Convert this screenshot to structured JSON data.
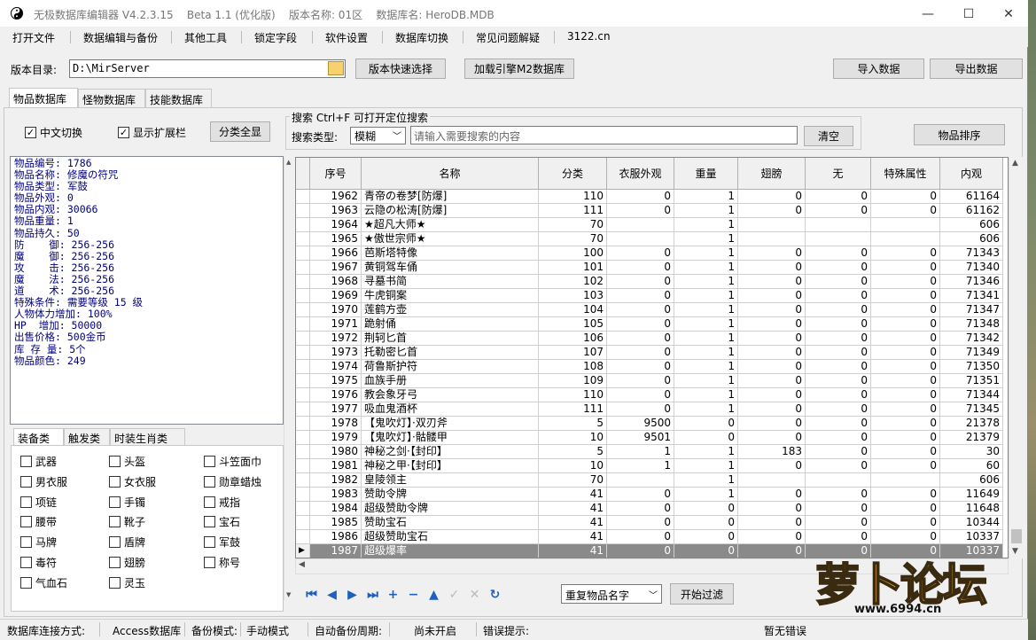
{
  "window": {
    "title_parts": [
      "无极数据库编辑器 V4.2.3.15",
      "Beta 1.1 (优化版)",
      "版本名称: 01区",
      "数据库名: HeroDB.MDB"
    ],
    "controls": [
      "—",
      "☐",
      "✕"
    ]
  },
  "menu": [
    "打开文件",
    "数据编辑与备份",
    "其他工具",
    "锁定字段",
    "软件设置",
    "数据库切换",
    "常见问题解疑",
    "3122.cn"
  ],
  "toolbar": {
    "dir_label": "版本目录:",
    "dir_value": "D:\\MirServer",
    "quick_select": "版本快速选择",
    "load_m2": "加载引擎M2数据库",
    "import": "导入数据",
    "export": "导出数据"
  },
  "tabs": [
    "物品数据库",
    "怪物数据库",
    "技能数据库"
  ],
  "options": {
    "chinese_switch": "中文切换",
    "show_ext": "显示扩展栏",
    "show_all": "分类全显",
    "sort": "物品排序"
  },
  "search": {
    "legend": "搜索  Ctrl+F 可打开定位搜索",
    "type_label": "搜索类型:",
    "type_value": "模糊",
    "placeholder": "请输入需要搜索的内容",
    "clear": "清空"
  },
  "item_info": [
    "物品编号: 1786",
    "物品名称: 修魔の符咒",
    "物品类型: 军鼓",
    "物品外观: 0",
    "物品内观: 30066",
    "物品重量: 1",
    "物品持久: 50",
    "防    御: 256-256",
    "魔    御: 256-256",
    "攻    击: 256-256",
    "魔    法: 256-256",
    "道    术: 256-256",
    "特殊条件: 需要等级 15 级",
    "人物体力增加: 100%",
    "HP  增加: 50000",
    "出售价格: 500金币",
    "库 存 量: 5个",
    "物品颜色: 249"
  ],
  "category_tabs": [
    "装备类",
    "触发类",
    "时装生肖类"
  ],
  "categories": [
    [
      "武器",
      "头盔",
      "斗笠面巾"
    ],
    [
      "男衣服",
      "女衣服",
      "勋章蜡烛"
    ],
    [
      "项链",
      "手镯",
      "戒指"
    ],
    [
      "腰带",
      "靴子",
      "宝石"
    ],
    [
      "马牌",
      "盾牌",
      "军鼓"
    ],
    [
      "毒符",
      "翅膀",
      "称号"
    ],
    [
      "气血石",
      "灵玉",
      ""
    ]
  ],
  "table": {
    "headers": [
      "序号",
      "名称",
      "分类",
      "衣服外观",
      "重量",
      "翅膀",
      "无",
      "特殊属性",
      "内观"
    ],
    "rows": [
      [
        "1962",
        "青帝の卷梦[防爆]",
        "110",
        "0",
        "1",
        "0",
        "0",
        "0",
        "61164"
      ],
      [
        "1963",
        "云隐の松涛[防爆]",
        "111",
        "0",
        "1",
        "0",
        "0",
        "0",
        "61162"
      ],
      [
        "1964",
        "★超凡大师★",
        "70",
        "",
        "1",
        "",
        "",
        "",
        "606"
      ],
      [
        "1965",
        "★傲世宗师★",
        "70",
        "",
        "1",
        "",
        "",
        "",
        "606"
      ],
      [
        "1966",
        "芭斯塔特像",
        "100",
        "0",
        "1",
        "0",
        "0",
        "0",
        "71343"
      ],
      [
        "1967",
        "黄铜驾车俑",
        "101",
        "0",
        "1",
        "0",
        "0",
        "0",
        "71340"
      ],
      [
        "1968",
        "寻墓书简",
        "102",
        "0",
        "1",
        "0",
        "0",
        "0",
        "71346"
      ],
      [
        "1969",
        "牛虎铜案",
        "103",
        "0",
        "1",
        "0",
        "0",
        "0",
        "71341"
      ],
      [
        "1970",
        "莲鹤方壶",
        "104",
        "0",
        "1",
        "0",
        "0",
        "0",
        "71347"
      ],
      [
        "1971",
        "跪射俑",
        "105",
        "0",
        "1",
        "0",
        "0",
        "0",
        "71348"
      ],
      [
        "1972",
        "荆轲匕首",
        "106",
        "0",
        "1",
        "0",
        "0",
        "0",
        "71342"
      ],
      [
        "1973",
        "托勒密匕首",
        "107",
        "0",
        "1",
        "0",
        "0",
        "0",
        "71349"
      ],
      [
        "1974",
        "荷鲁斯护符",
        "108",
        "0",
        "1",
        "0",
        "0",
        "0",
        "71350"
      ],
      [
        "1975",
        "血族手册",
        "109",
        "0",
        "1",
        "0",
        "0",
        "0",
        "71351"
      ],
      [
        "1976",
        "教会象牙弓",
        "110",
        "0",
        "1",
        "0",
        "0",
        "0",
        "71344"
      ],
      [
        "1977",
        "吸血鬼酒杯",
        "111",
        "0",
        "1",
        "0",
        "0",
        "0",
        "71345"
      ],
      [
        "1978",
        "【鬼吹灯】·双刃斧",
        "5",
        "9500",
        "0",
        "0",
        "0",
        "0",
        "21378"
      ],
      [
        "1979",
        "【鬼吹灯】·骷髅甲",
        "10",
        "9501",
        "0",
        "0",
        "0",
        "0",
        "21379"
      ],
      [
        "1980",
        "神秘之剑·【封印】",
        "5",
        "1",
        "1",
        "183",
        "0",
        "0",
        "30"
      ],
      [
        "1981",
        "神秘之甲·【封印】",
        "10",
        "1",
        "1",
        "0",
        "0",
        "0",
        "60"
      ],
      [
        "1982",
        "皇陵领主",
        "70",
        "",
        "1",
        "",
        "",
        "",
        "606"
      ],
      [
        "1983",
        "赞助令牌",
        "41",
        "0",
        "1",
        "0",
        "0",
        "0",
        "11649"
      ],
      [
        "1984",
        "超级赞助令牌",
        "41",
        "0",
        "0",
        "0",
        "0",
        "0",
        "11648"
      ],
      [
        "1985",
        "赞助宝石",
        "41",
        "0",
        "0",
        "0",
        "0",
        "0",
        "10344"
      ],
      [
        "1986",
        "超级赞助宝石",
        "41",
        "0",
        "0",
        "0",
        "0",
        "0",
        "10337"
      ],
      [
        "1987",
        "超级爆率",
        "41",
        "0",
        "0",
        "0",
        "0",
        "0",
        "10337"
      ]
    ],
    "selected_row": "1987"
  },
  "bottom": {
    "filter_value": "重复物品名字",
    "filter_btn": "开始过滤"
  },
  "status": {
    "conn_label": "数据库连接方式:",
    "conn_value": "Access数据库",
    "backup_label": "备份模式:",
    "backup_value": "手动模式",
    "auto_label": "自动备份周期:",
    "auto_value": "尚未开启",
    "error_label": "错误提示:",
    "error_value": "暂无错误"
  },
  "watermark": {
    "brand": "萝卜论坛",
    "url": "www.6994.cn"
  },
  "colors": {
    "info_text": "#000080",
    "nav_blue": "#1f5fbf",
    "selected_row": "#8a8a8a"
  }
}
